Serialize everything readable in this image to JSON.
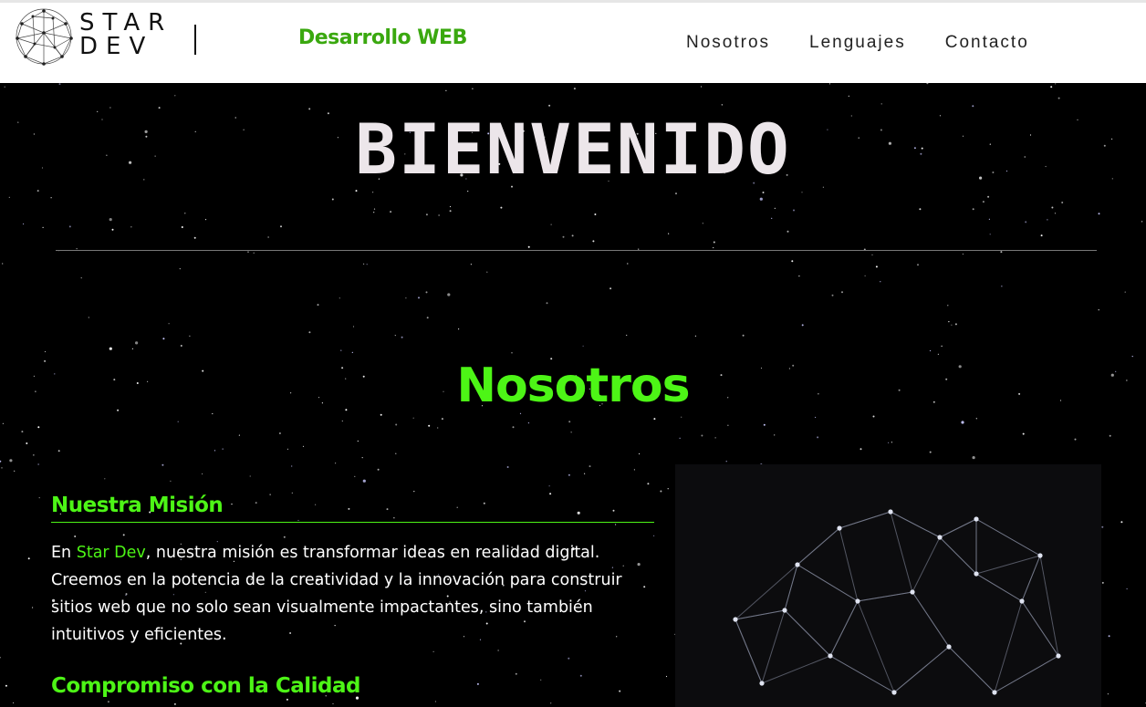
{
  "header": {
    "logo": {
      "line1": "STAR",
      "line2": "DEV"
    },
    "brand_title": "Desarrollo WEB",
    "nav": [
      {
        "label": "Nosotros"
      },
      {
        "label": "Lenguajes"
      },
      {
        "label": "Contacto"
      }
    ]
  },
  "hero": {
    "welcome": "BIENVENIDO"
  },
  "about": {
    "title": "Nosotros",
    "mission": {
      "heading": "Nuestra Misión",
      "text_before": "En ",
      "highlight": "Star Dev",
      "text_after": ", nuestra misión es transformar ideas en realidad digital. Creemos en la potencia de la creatividad y la innovación para construir sitios web que no solo sean visualmente impactantes, sino también intuitivos y eficientes."
    },
    "quality": {
      "heading": "Compromiso con la Calidad"
    }
  },
  "colors": {
    "accent_green": "#4df516",
    "brand_green": "#3aa80f",
    "background": "#000000",
    "header_bg": "#ffffff"
  }
}
